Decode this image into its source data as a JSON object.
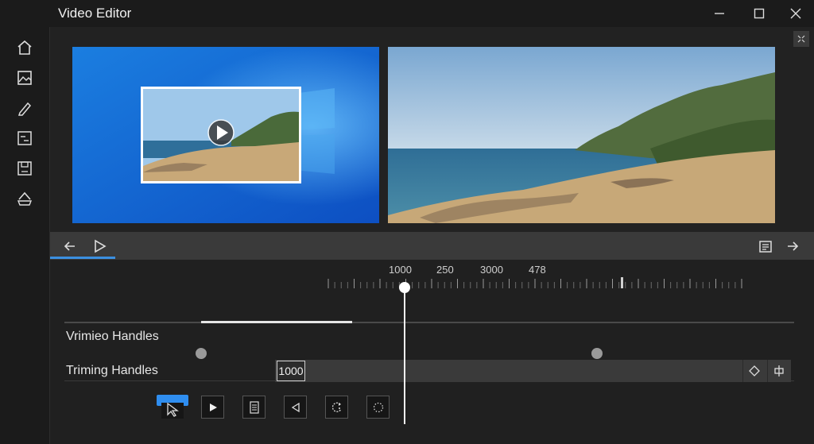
{
  "window": {
    "title": "Video Editor",
    "controls": [
      "minimize-icon",
      "maximize-icon",
      "close-icon"
    ]
  },
  "sidebar": {
    "items": [
      {
        "name": "home",
        "icon": "home-icon"
      },
      {
        "name": "media",
        "icon": "image-icon"
      },
      {
        "name": "edit",
        "icon": "pencil-icon"
      },
      {
        "name": "adjust",
        "icon": "adjust-panel-icon"
      },
      {
        "name": "save",
        "icon": "save-icon"
      },
      {
        "name": "export",
        "icon": "export-icon"
      }
    ]
  },
  "preview": {
    "left_pane": "windows-desktop-thumbnail-with-play",
    "right_pane": "coastal-beach-video-frame",
    "collapse_icon": "collapse-icon"
  },
  "toolbar": {
    "left_icons": [
      "back-arrow-icon",
      "play-icon"
    ],
    "right_icons": [
      "notes-icon",
      "forward-arrow-icon"
    ]
  },
  "timeline": {
    "tick_labels": [
      "1000",
      "250",
      "3000",
      "478"
    ],
    "rows": [
      {
        "label": "Vrimieo Handles"
      },
      {
        "label": "Triming Handles",
        "value": "1000"
      }
    ],
    "trim_icons": [
      "diamond-icon",
      "split-icon"
    ],
    "controls": [
      "select-tool-icon",
      "play-icon",
      "document-icon",
      "rewind-icon",
      "rotate-icon",
      "crop-circle-icon"
    ]
  },
  "colors": {
    "accent": "#3b8fe0",
    "background": "#202020",
    "toolbar": "#3a3a3a"
  }
}
